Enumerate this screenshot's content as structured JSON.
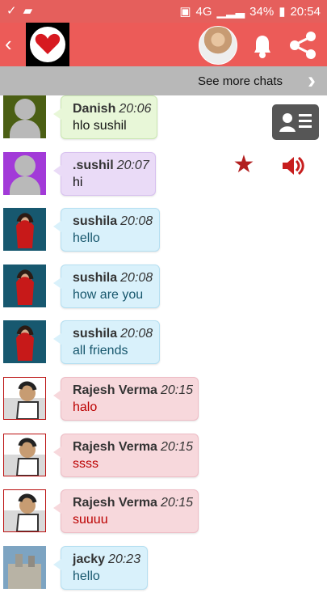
{
  "status_bar": {
    "network": "4G",
    "battery": "34%",
    "time": "20:54"
  },
  "header": {
    "back_icon": "chevron-left-icon",
    "logo_icon": "heart-logo-icon",
    "profile_icon": "profile-avatar",
    "notification_icon": "bell-icon",
    "share_icon": "share-icon"
  },
  "see_more": {
    "label": "See more chats"
  },
  "actions": {
    "contact_card_icon": "contact-card-icon",
    "favorite_icon": "star-icon",
    "sound_icon": "speaker-icon"
  },
  "messages": [
    {
      "name": "Danish",
      "time": "20:06",
      "text": "hlo sushil"
    },
    {
      "name": ".sushil",
      "time": "20:07",
      "text": "hi"
    },
    {
      "name": "sushila",
      "time": "20:08",
      "text": "hello"
    },
    {
      "name": "sushila",
      "time": "20:08",
      "text": "how are you"
    },
    {
      "name": "sushila",
      "time": "20:08",
      "text": "all friends"
    },
    {
      "name": "Rajesh Verma",
      "time": "20:15",
      "text": "halo"
    },
    {
      "name": "Rajesh Verma",
      "time": "20:15",
      "text": "ssss"
    },
    {
      "name": "Rajesh Verma",
      "time": "20:15",
      "text": "suuuu"
    },
    {
      "name": "jacky",
      "time": "20:23",
      "text": "hello"
    }
  ],
  "colors": {
    "app_bar": "#ec5b58",
    "status_bar": "#e55f5c",
    "see_more_bar": "#b8b8b8"
  }
}
